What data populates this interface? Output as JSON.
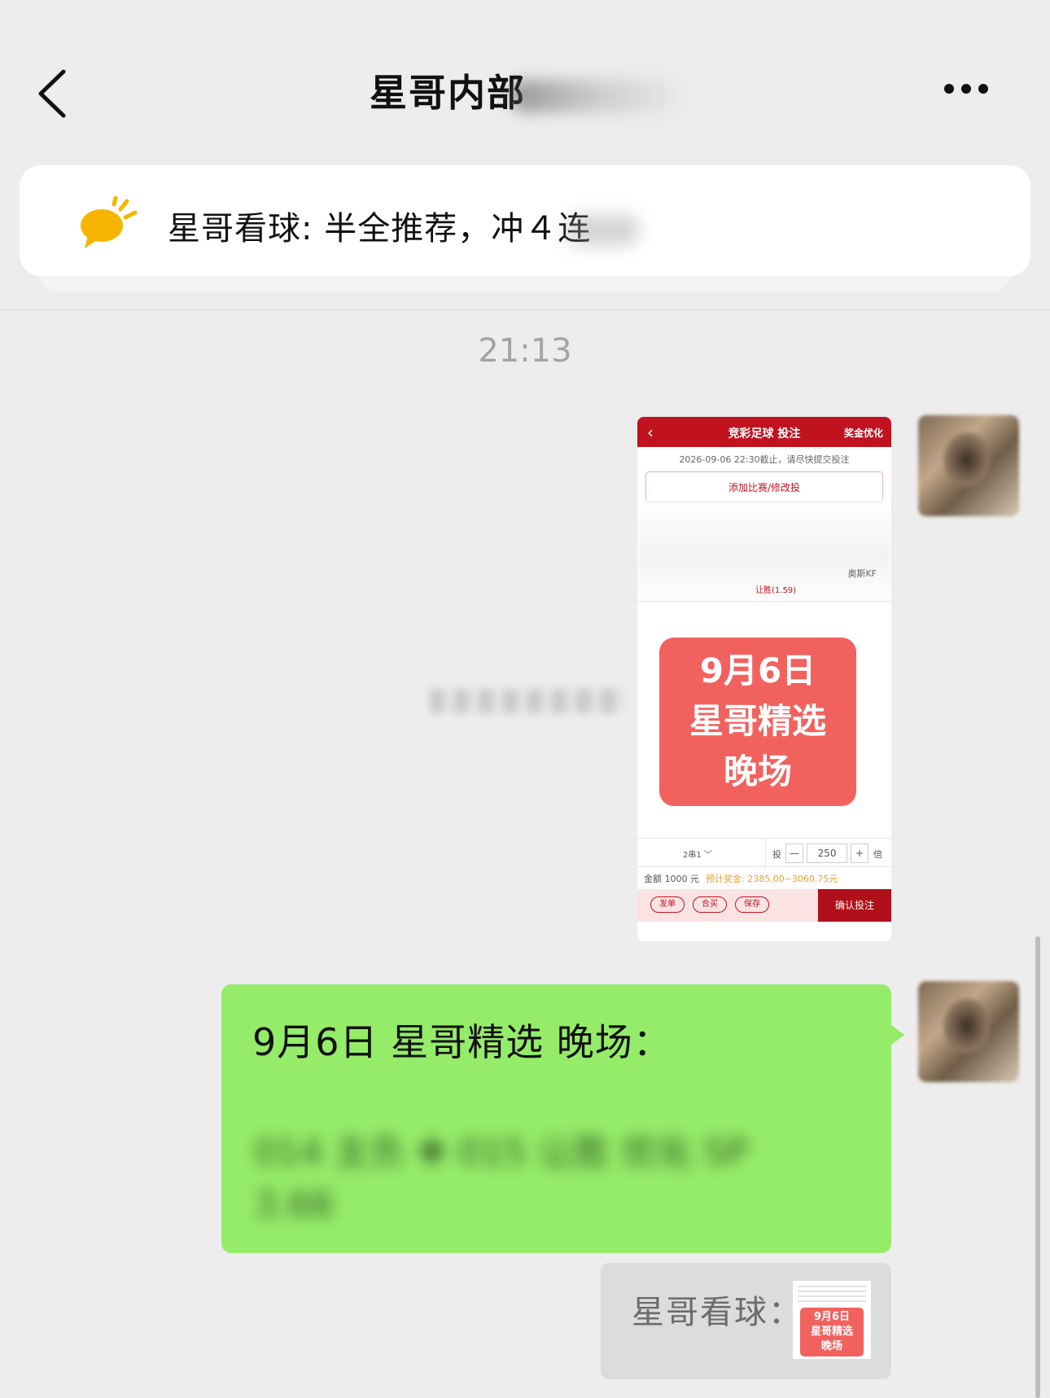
{
  "header": {
    "title": "星哥内部",
    "back_icon": "chevron-left-icon",
    "more_icon": "more-dots-icon"
  },
  "pinned": {
    "icon": "announcement-bubble-icon",
    "icon_color": "#f7b500",
    "text": "星哥看球: 半全推荐，冲４连"
  },
  "timestamp": "21:13",
  "image_message": {
    "header_title": "竞彩足球 投注",
    "header_right": "奖金优化",
    "deadline": "2026-09-06 22:30截止，请尽快提交投注",
    "add_match": "添加比赛/修改投",
    "team": "奥斯KF",
    "odds": "让胜(1.59)",
    "banner_line1": "9月6日",
    "banner_line2": "星哥精选",
    "banner_line3": "晚场",
    "banner_color": "#f1625f",
    "pass_type": "2串1 ﹀",
    "tou": "投",
    "minus": "—",
    "multiplier": "250",
    "plus": "+",
    "bei": "倍",
    "amount": "金额  1000 元",
    "prize": "预计奖金:  2385.00~3060.75元",
    "btn_fadan": "发单",
    "btn_hemai": "合买",
    "btn_baocun": "保存",
    "btn_confirm": "确认投注"
  },
  "text_message": {
    "line1": "9月6日 星哥精选 晚场：",
    "blurred": "014 主负 ✚ 015 让胜 优化 SP 3.66",
    "bubble_color": "#95ec69"
  },
  "quote": {
    "label": "星哥看球：",
    "thumb_line1": "9月6日",
    "thumb_line2": "星哥精选",
    "thumb_line3": "晚场"
  }
}
